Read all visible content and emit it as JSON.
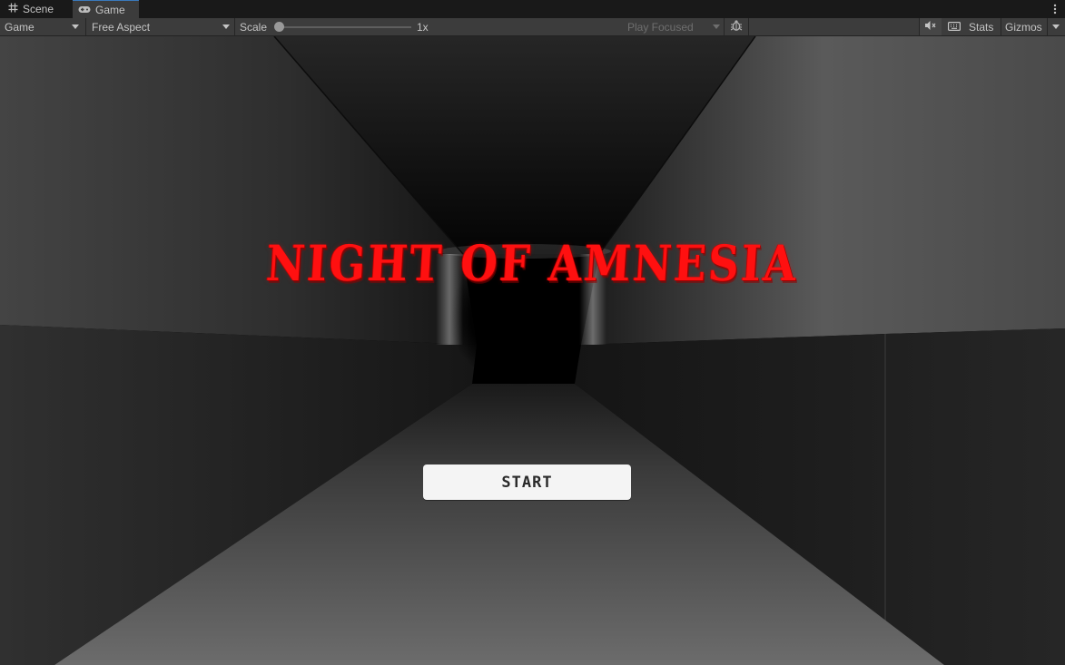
{
  "tabs": [
    {
      "label": "Scene",
      "icon": "grid-icon"
    },
    {
      "label": "Game",
      "icon": "gamepad-icon"
    }
  ],
  "toolbar": {
    "display_select": "Game",
    "aspect_select": "Free Aspect",
    "scale_label": "Scale",
    "scale_value": "1x",
    "play_mode_select": "Play Focused",
    "stats_label": "Stats",
    "gizmos_label": "Gizmos"
  },
  "game": {
    "title": "NIGHT OF AMNESIA",
    "start_button": "START"
  },
  "colors": {
    "title_red": "#ff1010",
    "editor_bg": "#3c3c3c",
    "tab_accent": "#3a79bb"
  }
}
